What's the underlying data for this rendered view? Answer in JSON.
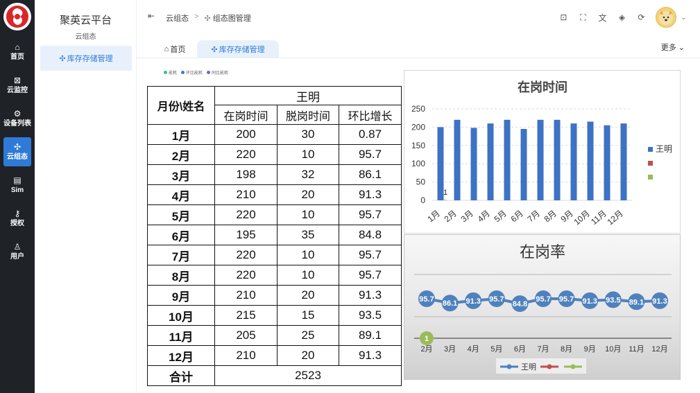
{
  "app": {
    "brand": "聚英云平台",
    "brand_sub": "云组态"
  },
  "rail": [
    {
      "label": "首页",
      "icon": "⌂"
    },
    {
      "label": "云监控",
      "icon": "⊠"
    },
    {
      "label": "设备列表",
      "icon": "⚙"
    },
    {
      "label": "云组态",
      "icon": "✣"
    },
    {
      "label": "Sim",
      "icon": "▤"
    },
    {
      "label": "授权",
      "icon": "⚷"
    },
    {
      "label": "用户",
      "icon": "♙"
    }
  ],
  "side2": {
    "item": "库存存储管理",
    "item_icon": "✣"
  },
  "breadcrumb": {
    "root": "云组态",
    "sep": ">",
    "current": "组态图管理",
    "current_icon": "✣"
  },
  "tabs": {
    "home": "首页",
    "home_icon": "⌂",
    "active": "库存存储管理",
    "active_icon": "✣",
    "more": "更多"
  },
  "mini_legend": [
    "能耗",
    "环比能耗",
    "同比能耗"
  ],
  "mini_legend_colors": [
    "#2ec4a0",
    "#3a7bd5",
    "#7b61c9"
  ],
  "table": {
    "corner": "月份\\姓名",
    "person": "王明",
    "cols": [
      "在岗时间",
      "脱岗时间",
      "环比增长"
    ],
    "rows": [
      {
        "month": "1月",
        "on": "200",
        "off": "30",
        "growth": "0.87"
      },
      {
        "month": "2月",
        "on": "220",
        "off": "10",
        "growth": "95.7"
      },
      {
        "month": "3月",
        "on": "198",
        "off": "32",
        "growth": "86.1"
      },
      {
        "month": "4月",
        "on": "210",
        "off": "20",
        "growth": "91.3"
      },
      {
        "month": "5月",
        "on": "220",
        "off": "10",
        "growth": "95.7"
      },
      {
        "month": "6月",
        "on": "195",
        "off": "35",
        "growth": "84.8"
      },
      {
        "month": "7月",
        "on": "220",
        "off": "10",
        "growth": "95.7"
      },
      {
        "month": "8月",
        "on": "220",
        "off": "10",
        "growth": "95.7"
      },
      {
        "month": "9月",
        "on": "210",
        "off": "20",
        "growth": "91.3"
      },
      {
        "month": "10月",
        "on": "215",
        "off": "15",
        "growth": "93.5"
      },
      {
        "month": "11月",
        "on": "205",
        "off": "25",
        "growth": "89.1"
      },
      {
        "month": "12月",
        "on": "210",
        "off": "20",
        "growth": "91.3"
      }
    ],
    "total_label": "合计",
    "total_value": "2523"
  },
  "chart_data": [
    {
      "type": "bar",
      "title": "在岗时间",
      "categories": [
        "1月",
        "2月",
        "3月",
        "4月",
        "5月",
        "6月",
        "7月",
        "8月",
        "9月",
        "10月",
        "11月",
        "12月"
      ],
      "series": [
        {
          "name": "王明",
          "values": [
            200,
            220,
            198,
            210,
            220,
            195,
            220,
            220,
            210,
            215,
            205,
            210
          ],
          "color": "#3d72c4"
        },
        {
          "name": "",
          "values": [
            1,
            0,
            0,
            0,
            0,
            0,
            0,
            0,
            0,
            0,
            0,
            0
          ],
          "color": "#c0504d"
        },
        {
          "name": "",
          "values": [
            0,
            0,
            0,
            0,
            0,
            0,
            0,
            0,
            0,
            0,
            0,
            0
          ],
          "color": "#9bbb59"
        }
      ],
      "data_labels": [
        {
          "category": "1月",
          "text": "1"
        }
      ],
      "yticks": [
        0,
        50,
        100,
        150,
        200,
        250
      ],
      "ylim": [
        0,
        250
      ],
      "grid": true,
      "legend": "right"
    },
    {
      "type": "line",
      "title": "在岗率",
      "categories": [
        "2月",
        "3月",
        "4月",
        "5月",
        "6月",
        "7月",
        "8月",
        "9月",
        "10月",
        "11月",
        "12月"
      ],
      "series": [
        {
          "name": "王明",
          "values": [
            95.7,
            86.1,
            91.3,
            95.7,
            84.8,
            95.7,
            95.7,
            91.3,
            93.5,
            89.1,
            91.3
          ],
          "color": "#4f81bd"
        },
        {
          "name": "",
          "values": [],
          "color": "#c0504d"
        },
        {
          "name": "",
          "values": [
            1
          ],
          "color": "#9bbb59"
        }
      ],
      "legend": "bottom"
    }
  ]
}
